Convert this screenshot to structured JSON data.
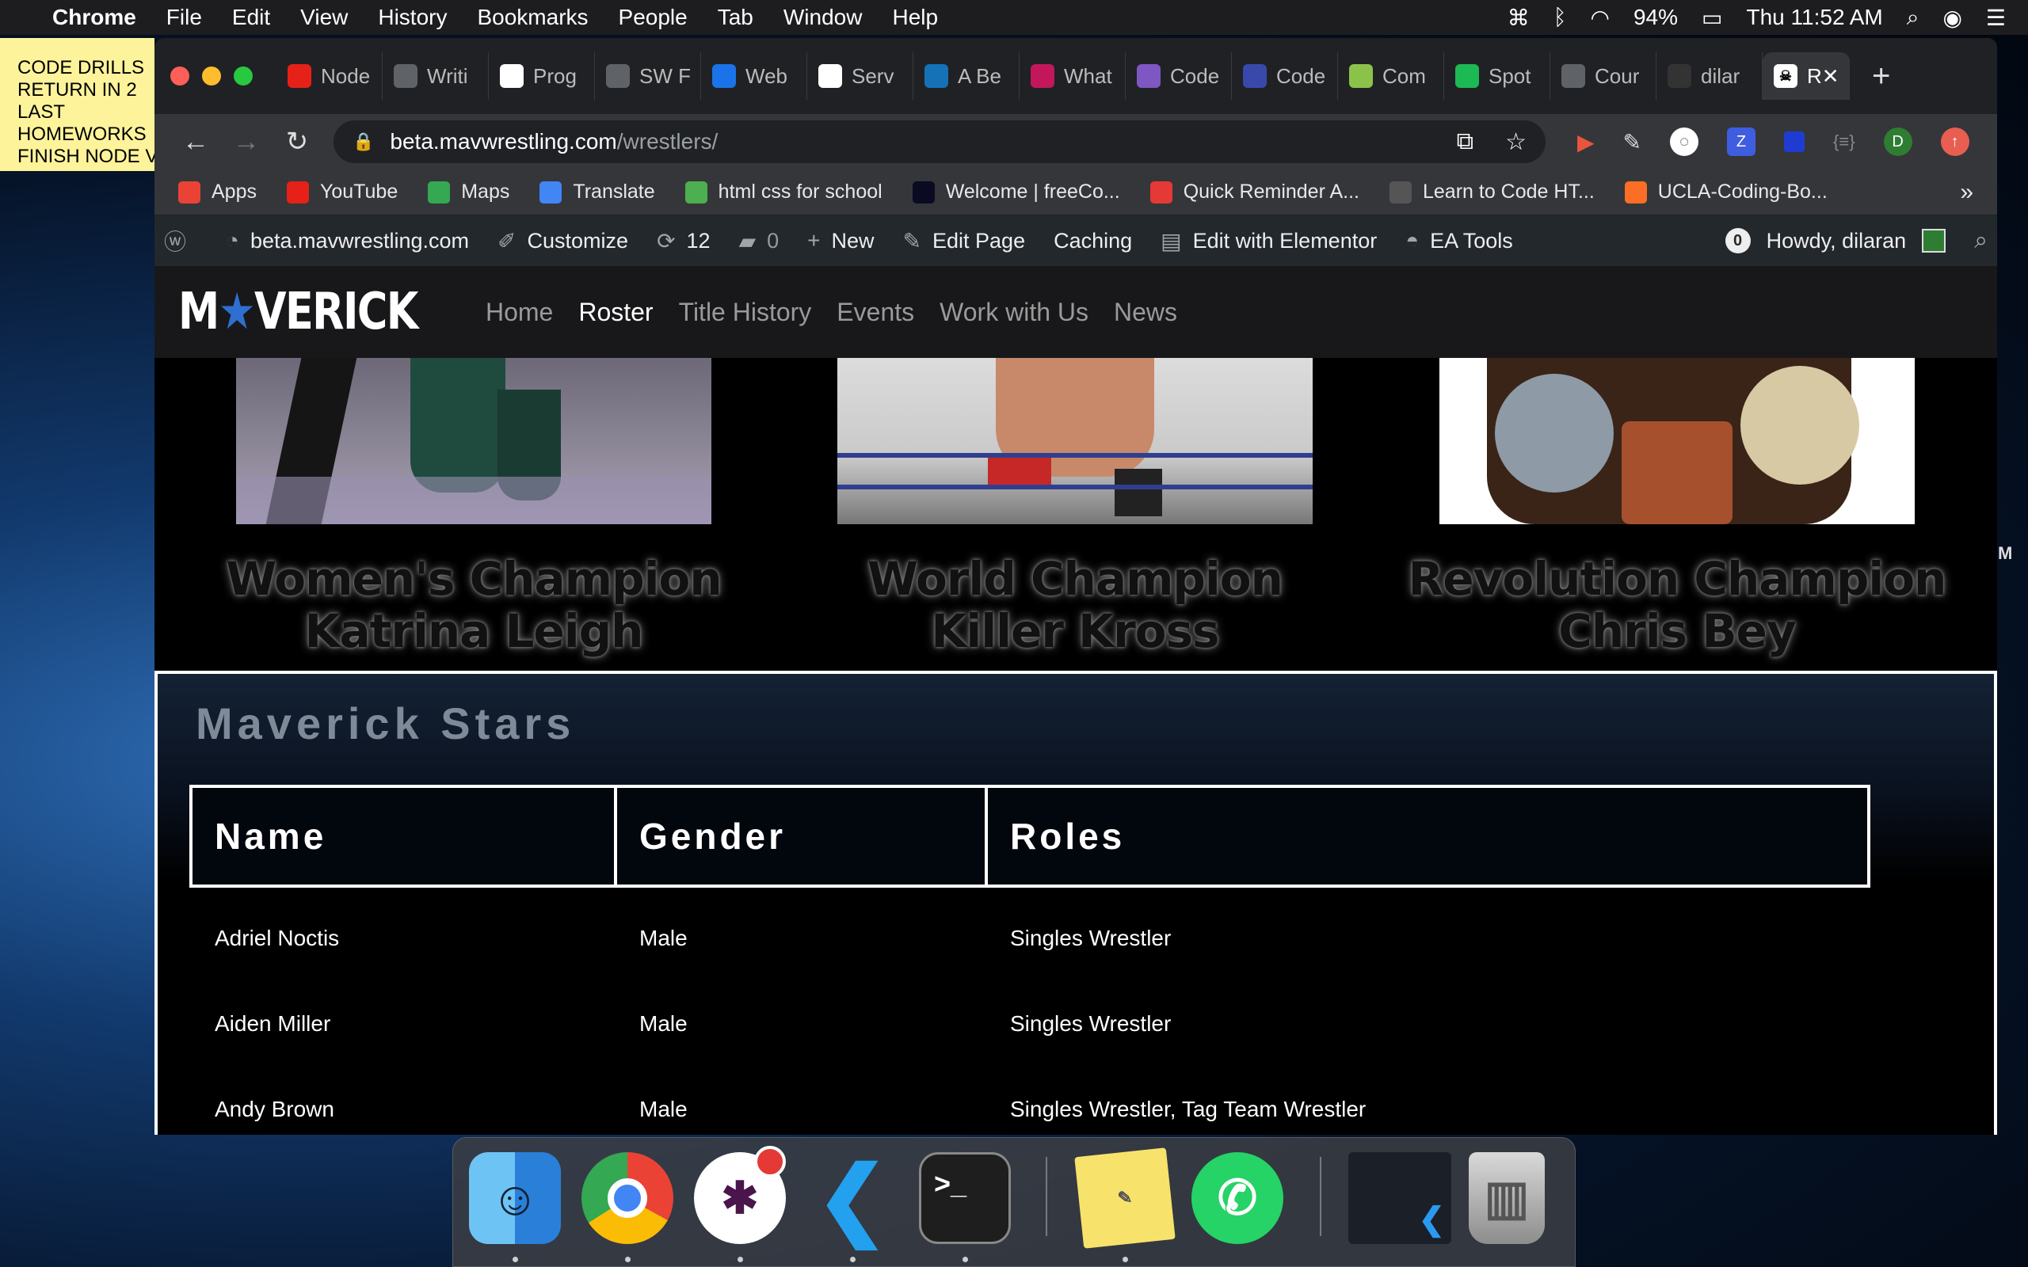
{
  "menubar": {
    "apple": "",
    "app": "Chrome",
    "items": [
      "File",
      "Edit",
      "View",
      "History",
      "Bookmarks",
      "People",
      "Tab",
      "Window",
      "Help"
    ],
    "battery": "94%",
    "clock": "Thu 11:52 AM"
  },
  "sticky": {
    "lines": [
      "CODE DRILLS",
      "RETURN IN 2",
      "LAST",
      "HOMEWORKS",
      "FINISH NODE V"
    ]
  },
  "edge_letter": "M",
  "tabs": [
    {
      "label": "Node",
      "icon": "youtube-icon",
      "color": "#e62117"
    },
    {
      "label": "Writi",
      "icon": "book-icon",
      "color": "#5f6368"
    },
    {
      "label": "Prog",
      "icon": "wikipedia-icon",
      "color": "#ffffff"
    },
    {
      "label": "SW F",
      "icon": "globe-icon",
      "color": "#5f6368"
    },
    {
      "label": "Web",
      "icon": "web-icon",
      "color": "#1a73e8"
    },
    {
      "label": "Serv",
      "icon": "serv-icon",
      "color": "#ffffff"
    },
    {
      "label": "A Be",
      "icon": "css3-icon",
      "color": "#1572b6"
    },
    {
      "label": "What",
      "icon": "heart-icon",
      "color": "#c2185b"
    },
    {
      "label": "Code",
      "icon": "cube-icon",
      "color": "#7e57c2"
    },
    {
      "label": "Code",
      "icon": "s-icon",
      "color": "#3949ab"
    },
    {
      "label": "Com",
      "icon": "leaf-icon",
      "color": "#8bc34a"
    },
    {
      "label": "Spot",
      "icon": "spotify-icon",
      "color": "#1db954"
    },
    {
      "label": "Cour",
      "icon": "globe-icon",
      "color": "#5f6368"
    },
    {
      "label": "dilar",
      "icon": "github-icon",
      "color": "#333333"
    }
  ],
  "active_tab": {
    "label": "R",
    "icon": "skull-icon"
  },
  "address": {
    "host": "beta.mavwrestling.com",
    "path": "/wrestlers/"
  },
  "bookmarks": [
    {
      "label": "Apps",
      "icon": "apps-grid-icon",
      "color": "#ea4335"
    },
    {
      "label": "YouTube",
      "icon": "youtube-icon",
      "color": "#e62117"
    },
    {
      "label": "Maps",
      "icon": "maps-icon",
      "color": "#34a853"
    },
    {
      "label": "Translate",
      "icon": "translate-icon",
      "color": "#4285f4"
    },
    {
      "label": "html css for school",
      "icon": "w3-icon",
      "color": "#4caf50"
    },
    {
      "label": "Welcome | freeCo...",
      "icon": "freecodecamp-icon",
      "color": "#0a0a23"
    },
    {
      "label": "Quick Reminder A...",
      "icon": "reminder-icon",
      "color": "#e53935"
    },
    {
      "label": "Learn to Code HT...",
      "icon": "code-brackets-icon",
      "color": "#555555"
    },
    {
      "label": "UCLA-Coding-Bo...",
      "icon": "gitlab-icon",
      "color": "#fc6d26"
    }
  ],
  "bookmarks_more": "»",
  "wpbar": {
    "site": "beta.mavwrestling.com",
    "customize": "Customize",
    "updates": "12",
    "comments": "0",
    "new": "New",
    "edit_page": "Edit Page",
    "caching": "Caching",
    "elementor": "Edit with Elementor",
    "ea_tools": "EA Tools",
    "notifications": "0",
    "howdy": "Howdy, dilaran"
  },
  "site": {
    "logo": {
      "part1": "M",
      "part2": "VERICK"
    },
    "nav": [
      "Home",
      "Roster",
      "Title History",
      "Events",
      "Work with Us",
      "News"
    ],
    "active_nav": "Roster"
  },
  "champions": [
    {
      "line1": "Women's Champion",
      "line2": "Katrina Leigh"
    },
    {
      "line1": "World Champion",
      "line2": "Killer Kross"
    },
    {
      "line1": "Revolution Champion",
      "line2": "Chris Bey"
    }
  ],
  "stars": {
    "title": "Maverick Stars",
    "headers": [
      "Name",
      "Gender",
      "Roles"
    ],
    "rows": [
      {
        "name": "Adriel Noctis",
        "gender": "Male",
        "roles": "Singles Wrestler"
      },
      {
        "name": "Aiden Miller",
        "gender": "Male",
        "roles": "Singles Wrestler"
      },
      {
        "name": "Andy Brown",
        "gender": "Male",
        "roles": "Singles Wrestler, Tag Team Wrestler"
      }
    ]
  },
  "dock": {
    "apps": [
      "finder-icon",
      "chrome-icon",
      "slack-icon",
      "vscode-icon",
      "terminal-icon",
      "stickies-icon",
      "whatsapp-icon",
      "vscode-window-icon",
      "trash-icon"
    ],
    "slack_badge": ""
  }
}
